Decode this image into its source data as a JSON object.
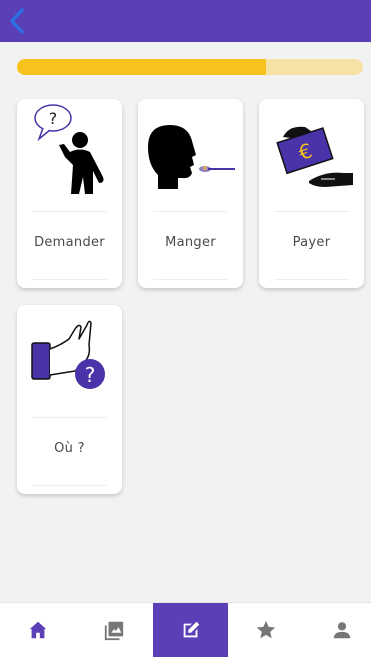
{
  "header": {
    "back_icon": "chevron-left-icon",
    "background": "#5b3fb7",
    "accent": "#2f6fe6"
  },
  "progress": {
    "fraction": 0.72,
    "fill_color": "#f7c21c",
    "track_color": "#f7e2a6"
  },
  "cards": [
    {
      "label": "Demander",
      "icon": "person-asking-icon"
    },
    {
      "label": "Manger",
      "icon": "eating-spoon-icon"
    },
    {
      "label": "Payer",
      "icon": "pay-euro-icon"
    },
    {
      "label": "Où ?",
      "icon": "where-hand-question-icon"
    }
  ],
  "bottom_nav": {
    "items": [
      {
        "icon": "home-icon",
        "active": false
      },
      {
        "icon": "gallery-icon",
        "active": false
      },
      {
        "icon": "edit-icon",
        "active": true
      },
      {
        "icon": "star-icon",
        "active": false
      },
      {
        "icon": "profile-icon",
        "active": false
      }
    ],
    "active_color": "#5b3fb7",
    "icon_color": "#5b3fb7"
  }
}
